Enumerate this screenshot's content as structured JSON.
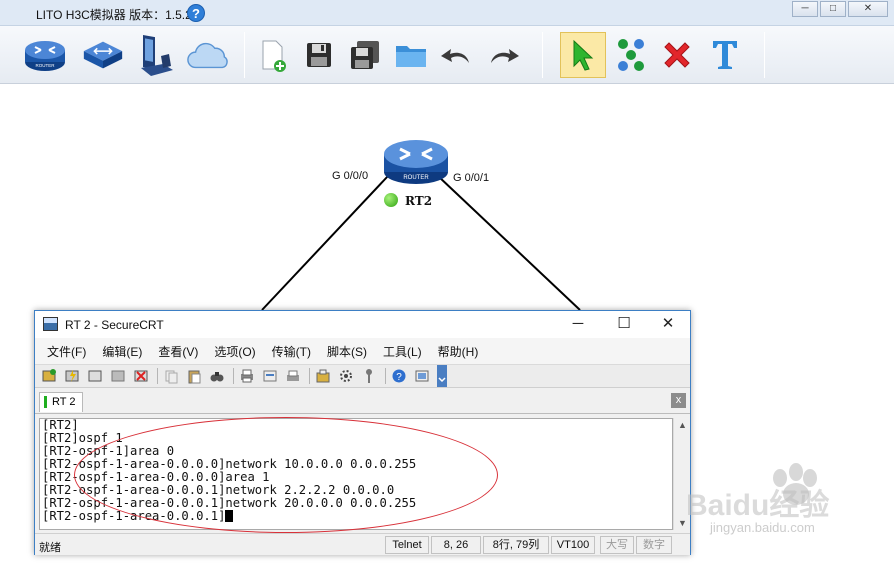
{
  "window": {
    "title": "LITO H3C模拟器 版本：1.5.2",
    "help_glyph": "?",
    "controls": [
      "─",
      "□",
      "✕"
    ]
  },
  "toolbar": {
    "icons": [
      "router-icon",
      "switch-icon",
      "pc-icon",
      "cloud-icon",
      "new-file-icon",
      "save-icon",
      "save-as-icon",
      "open-folder-icon",
      "undo-icon",
      "redo-icon",
      "select-pointer-icon",
      "connect-icon",
      "delete-icon",
      "text-icon"
    ]
  },
  "canvas": {
    "router": {
      "name": "RT2",
      "label": "ROUTER",
      "status": "running"
    },
    "iface_left": "G 0/0/0",
    "iface_right": "G 0/0/1"
  },
  "crt": {
    "title": "RT 2 - SecureCRT",
    "controls": {
      "min": "─",
      "max": "☐",
      "close": "✕"
    },
    "menu": [
      "文件(F)",
      "编辑(E)",
      "查看(V)",
      "选项(O)",
      "传输(T)",
      "脚本(S)",
      "工具(L)",
      "帮助(H)"
    ],
    "tab": {
      "label": "RT 2",
      "close": "x"
    },
    "terminal_lines": [
      "[RT2]",
      "[RT2]ospf 1",
      "[RT2-ospf-1]area 0",
      "[RT2-ospf-1-area-0.0.0.0]network 10.0.0.0 0.0.0.255",
      "[RT2-ospf-1-area-0.0.0.0]area 1",
      "[RT2-ospf-1-area-0.0.0.1]network 2.2.2.2 0.0.0.0",
      "[RT2-ospf-1-area-0.0.0.1]network 20.0.0.0 0.0.0.255",
      "[RT2-ospf-1-area-0.0.0.1]"
    ],
    "status": {
      "ready": "就绪",
      "protocol": "Telnet",
      "position": "8,  26",
      "size": "8行, 79列",
      "emulation": "VT100",
      "caps": "大写",
      "num": "数字"
    }
  },
  "watermark": {
    "brand": "Baidu经验",
    "url": "jingyan.baidu.com"
  },
  "colors": {
    "annotation": "#d8323a",
    "titlebar": "#dfe9f5",
    "link_line": "#000000"
  }
}
